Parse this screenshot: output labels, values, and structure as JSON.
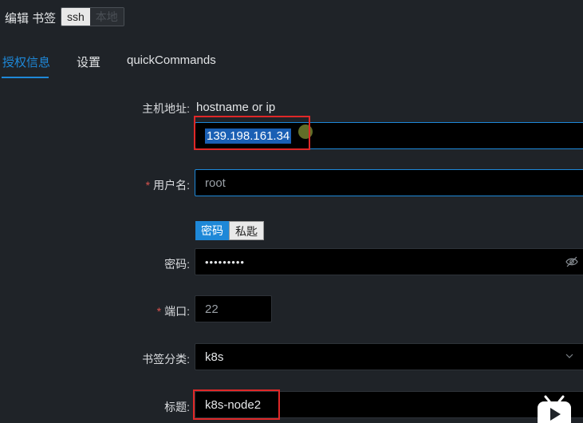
{
  "header": {
    "title": "编辑 书签",
    "segments": [
      {
        "label": "ssh",
        "active": true
      },
      {
        "label": "本地",
        "active": false
      }
    ]
  },
  "tabs": [
    {
      "label": "授权信息",
      "active": true
    },
    {
      "label": "设置",
      "active": false
    },
    {
      "label": "quickCommands",
      "active": false
    }
  ],
  "form": {
    "host": {
      "label": "主机地址:",
      "hint": "hostname or ip",
      "value": "139.198.161.34"
    },
    "username": {
      "label": "用户名:",
      "required_mark": "*",
      "value": "root"
    },
    "auth_type": {
      "options": [
        {
          "label": "密码",
          "active": true
        },
        {
          "label": "私匙",
          "active": false
        }
      ]
    },
    "password": {
      "label": "密码:",
      "value": "•••••••••"
    },
    "port": {
      "label": "端口:",
      "required_mark": "*",
      "value": "22"
    },
    "category": {
      "label": "书签分类:",
      "value": "k8s"
    },
    "title": {
      "label": "标题:",
      "value": "k8s-node2"
    }
  },
  "colors": {
    "accent": "#1e88d8",
    "annotation": "#e02828",
    "background": "#1f2328",
    "input_bg": "#000000"
  },
  "icons": {
    "password_toggle": "eye-slash-icon",
    "dropdown": "chevron-down-icon",
    "video": "video-play-icon"
  }
}
